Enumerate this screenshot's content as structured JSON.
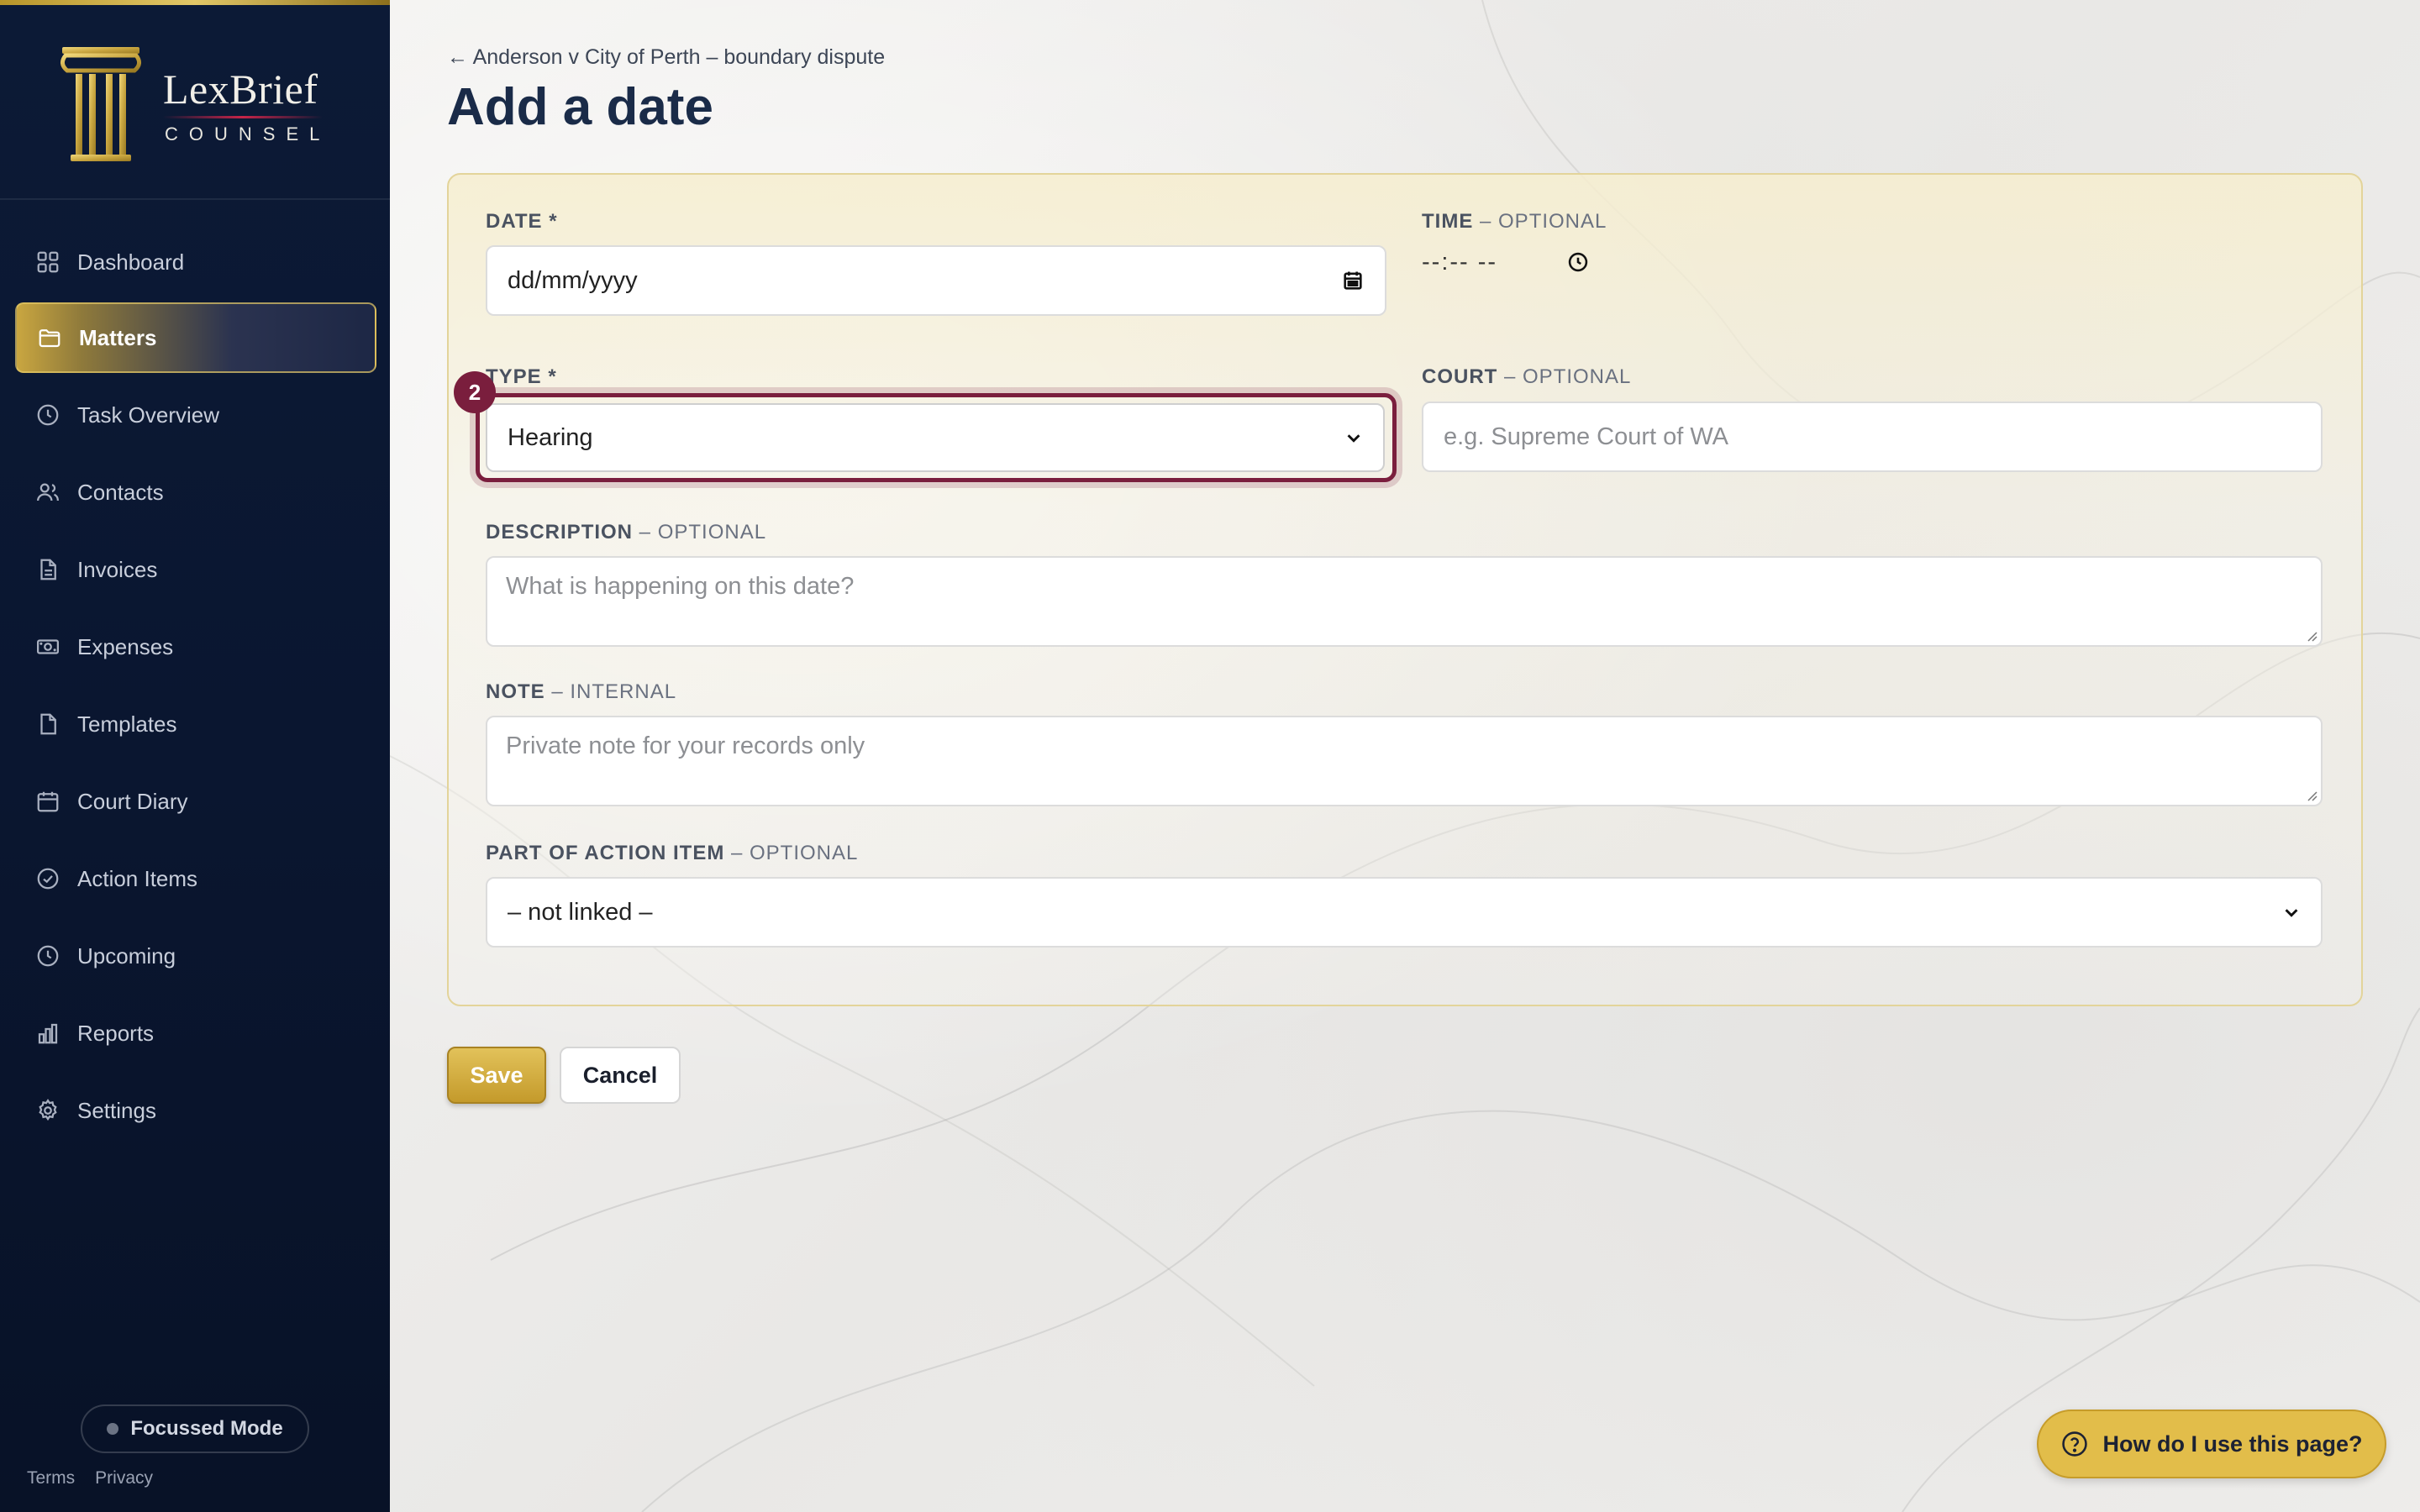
{
  "brand": {
    "name": "LexBrief",
    "sub": "COUNSEL"
  },
  "sidebar": {
    "items": [
      {
        "label": "Dashboard",
        "icon": "grid-icon"
      },
      {
        "label": "Matters",
        "icon": "folder-icon",
        "active": true
      },
      {
        "label": "Task Overview",
        "icon": "clock-icon"
      },
      {
        "label": "Contacts",
        "icon": "users-icon"
      },
      {
        "label": "Invoices",
        "icon": "file-icon"
      },
      {
        "label": "Expenses",
        "icon": "banknote-icon"
      },
      {
        "label": "Templates",
        "icon": "document-icon"
      },
      {
        "label": "Court Diary",
        "icon": "calendar-icon"
      },
      {
        "label": "Action Items",
        "icon": "check-circle-icon"
      },
      {
        "label": "Upcoming",
        "icon": "clock-icon"
      },
      {
        "label": "Reports",
        "icon": "bar-chart-icon"
      },
      {
        "label": "Settings",
        "icon": "gear-icon"
      }
    ],
    "focus_mode": "Focussed Mode",
    "footer": {
      "terms": "Terms",
      "privacy": "Privacy"
    }
  },
  "main": {
    "breadcrumb": "← Anderson v City of Perth – boundary dispute",
    "title": "Add a date",
    "form": {
      "date": {
        "label": "DATE *",
        "placeholder": "dd/mm/yyyy"
      },
      "time": {
        "label": "TIME",
        "optional": " – OPTIONAL",
        "value": "--:-- --"
      },
      "type": {
        "label": "TYPE *",
        "value": "Hearing",
        "step": "2"
      },
      "court": {
        "label": "COURT",
        "optional": " – OPTIONAL",
        "placeholder": "e.g. Supreme Court of WA"
      },
      "description": {
        "label": "DESCRIPTION",
        "optional": " – OPTIONAL",
        "placeholder": "What is happening on this date?"
      },
      "note": {
        "label": "NOTE",
        "optional": " – INTERNAL",
        "placeholder": "Private note for your records only"
      },
      "action_item": {
        "label": "PART OF ACTION ITEM",
        "optional": " – OPTIONAL",
        "value": "– not linked –"
      }
    },
    "buttons": {
      "save": "Save",
      "cancel": "Cancel"
    },
    "help": "How do I use this page?"
  },
  "colors": {
    "navy": "#0c1a36",
    "gold": "#c9a640",
    "burgundy": "#7a1e3d"
  }
}
